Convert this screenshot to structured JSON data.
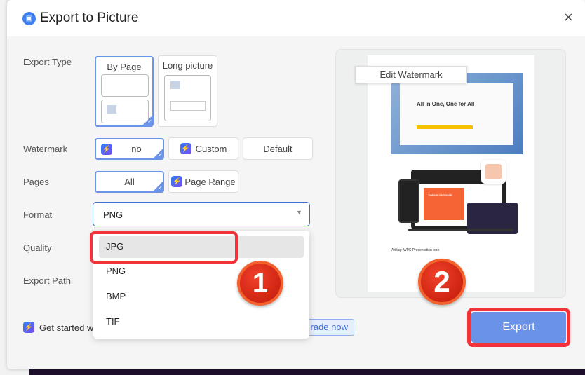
{
  "dialog": {
    "title": "Export to Picture",
    "close_label": "×"
  },
  "form": {
    "export_type": {
      "label": "Export Type",
      "options": [
        "By Page",
        "Long picture"
      ],
      "selected": "By Page"
    },
    "watermark": {
      "label": "Watermark",
      "options": [
        "no",
        "Custom",
        "Default"
      ],
      "selected": "no"
    },
    "pages": {
      "label": "Pages",
      "options": [
        "All",
        "Page Range"
      ],
      "selected": "All"
    },
    "format": {
      "label": "Format",
      "value": "PNG",
      "options": [
        "JPG",
        "PNG",
        "BMP",
        "TIF"
      ],
      "highlighted": "JPG"
    },
    "quality": {
      "label": "Quality"
    },
    "export_path": {
      "label": "Export Path"
    }
  },
  "promo": {
    "text": "Get started w",
    "upgrade_label": "rade now"
  },
  "preview": {
    "edit_watermark": "Edit Watermark",
    "headline": "All in One, One for All",
    "caption": "Alt tag: WPS Presentation icon",
    "slide_title": "THESIS DEFENSE"
  },
  "annotations": {
    "step1": "1",
    "step2": "2"
  },
  "export_button": "Export"
}
